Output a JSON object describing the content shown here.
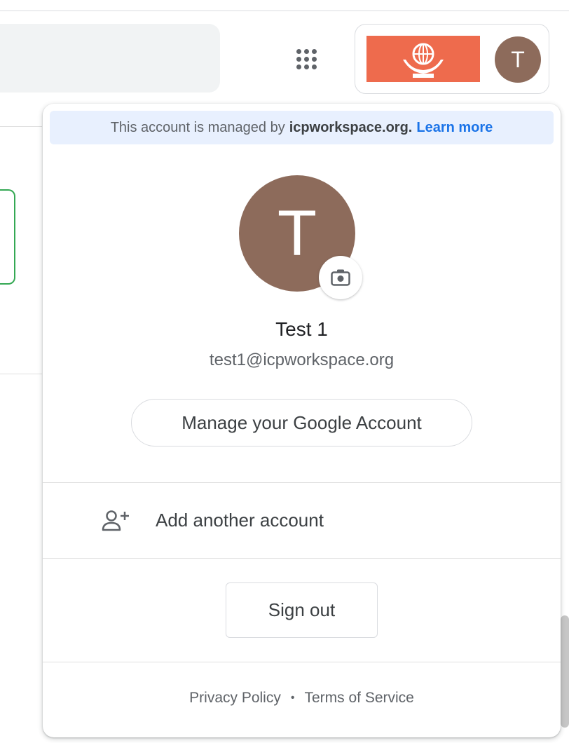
{
  "banner": {
    "prefix": "This account is managed by",
    "domain": "icpworkspace.org.",
    "learn_more": "Learn more"
  },
  "account_chip": {
    "avatar_initial": "T",
    "logo_color": "#ee6b4d"
  },
  "profile": {
    "avatar_initial": "T",
    "avatar_color": "#8d6b5b",
    "name": "Test 1",
    "email": "test1@icpworkspace.org"
  },
  "actions": {
    "manage_account": "Manage your Google Account",
    "add_account": "Add another account",
    "sign_out": "Sign out"
  },
  "footer": {
    "privacy": "Privacy Policy",
    "separator": "•",
    "terms": "Terms of Service"
  },
  "icons": {
    "apps": "apps-grid-icon",
    "camera": "camera-icon",
    "add_account": "person-add-icon"
  },
  "colors": {
    "banner_bg": "#e8f0fe",
    "link": "#1a73e8"
  }
}
